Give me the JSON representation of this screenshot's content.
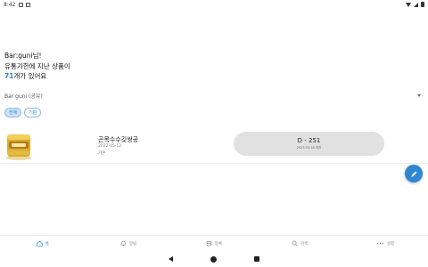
{
  "status_bar": {
    "time": "8:42"
  },
  "greeting": {
    "line1": "Bar:guni님!",
    "line2": "유통기한에 지난 상품이",
    "count": "71",
    "line3_suffix": "개가 있어요"
  },
  "group_select": {
    "value": "Bar:guni (공유)"
  },
  "chips": [
    {
      "label": "전체",
      "active": true
    },
    {
      "label": "기본",
      "active": false
    }
  ],
  "products": [
    {
      "name": "곤목수수깃쌍공",
      "date": "2022-05-12",
      "group": "기본",
      "dday": "D - 251",
      "dday_date": "2023.01.18 까지"
    }
  ],
  "fab": {
    "icon": "pencil-icon"
  },
  "bottom_nav": [
    {
      "label": "홈",
      "icon": "home-icon",
      "active": true
    },
    {
      "label": "알림",
      "icon": "bell-icon",
      "active": false
    },
    {
      "label": "등록",
      "icon": "register-icon",
      "active": false
    },
    {
      "label": "검색",
      "icon": "search-icon",
      "active": false
    },
    {
      "label": "설정",
      "icon": "more-icon",
      "active": false
    }
  ],
  "colors": {
    "accent": "#2f86d1",
    "dday_bg": "#e1e1e1"
  }
}
